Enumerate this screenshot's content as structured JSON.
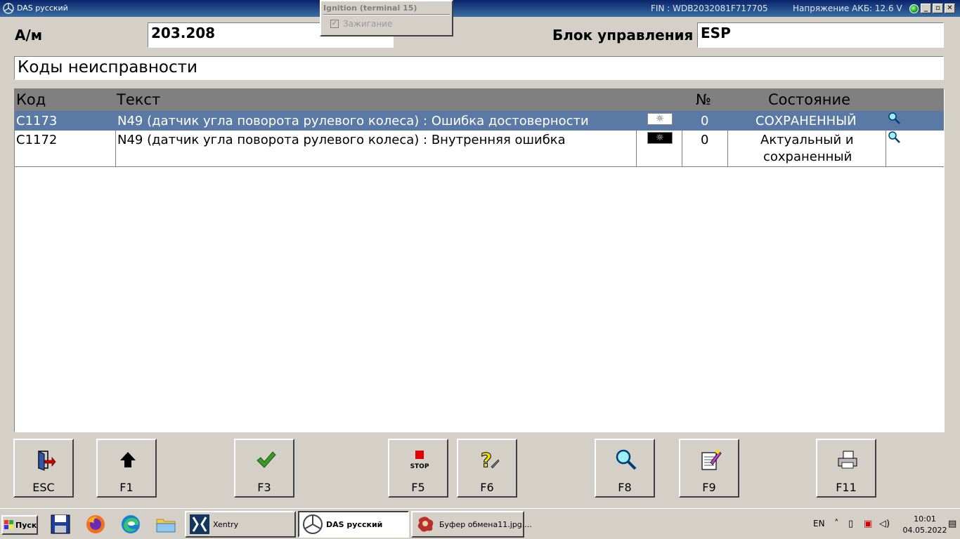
{
  "window": {
    "title": "DAS русский",
    "fin": "FIN : WDB2032081F717705",
    "voltage": "Напряжение АКБ: 12.6 V",
    "minimize": "_",
    "restore": "▫",
    "close": "✕"
  },
  "ignition": {
    "title": "Ignition (terminal 15)",
    "checkbox_label": "Зажигание",
    "checked": true
  },
  "header": {
    "vehicle_label": "А/м",
    "vehicle_value": "203.208",
    "ecu_label": "Блок управления",
    "ecu_value": "ESP"
  },
  "section_title": "Коды неисправности",
  "table": {
    "columns": [
      "Код",
      "Текст",
      "№",
      "Состояние"
    ],
    "rows": [
      {
        "code": "C1173",
        "text": "N49 (датчик угла поворота рулевого колеса) : Ошибка достоверности",
        "lamp": "light",
        "count": "0",
        "status_line1": "СОХРАНЕННЫЙ",
        "status_line2": "",
        "selected": true
      },
      {
        "code": "C1172",
        "text": "N49 (датчик угла поворота рулевого колеса) : Внутренняя ошибка",
        "lamp": "dark",
        "count": "0",
        "status_line1": "Актуальный и",
        "status_line2": "сохраненный",
        "selected": false
      }
    ]
  },
  "fkeys": [
    {
      "label": "ESC",
      "icon": "exit-door-icon"
    },
    {
      "label": "F1",
      "icon": "arrow-up-icon"
    },
    {
      "label": "F3",
      "icon": "checkmark-icon"
    },
    {
      "label": "F5",
      "icon": "stop-icon",
      "sublabel": "STOP"
    },
    {
      "label": "F6",
      "icon": "help-question-icon"
    },
    {
      "label": "F8",
      "icon": "magnifier-icon"
    },
    {
      "label": "F9",
      "icon": "notepad-icon"
    },
    {
      "label": "F11",
      "icon": "printer-icon"
    }
  ],
  "taskbar": {
    "start_label": "Пуск",
    "tasks": [
      {
        "label": "Xentry",
        "icon": "xentry-icon",
        "active": false
      },
      {
        "label": "DAS русский",
        "icon": "mercedes-star-icon",
        "active": true
      },
      {
        "label": "Буфер обмена11.jpg....",
        "icon": "paint-splash-icon",
        "active": false
      }
    ],
    "language": "EN",
    "time": "10:01",
    "date": "04.05.2022"
  },
  "colors": {
    "selected_row": "#5a7aa5",
    "header_bar": "#808080",
    "titlebar_start": "#0a246a",
    "titlebar_end": "#3a6ea5"
  }
}
